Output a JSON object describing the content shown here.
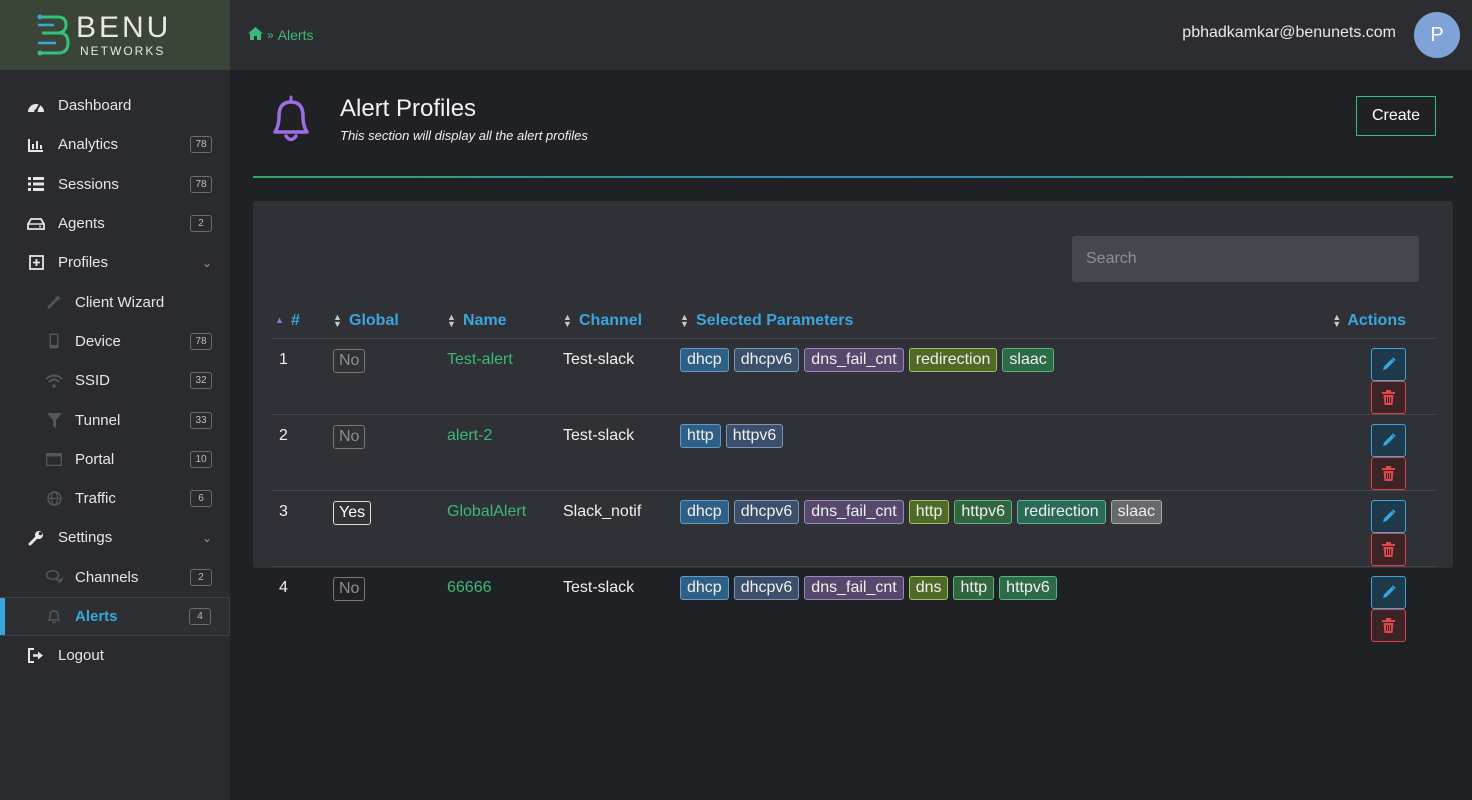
{
  "brand": {
    "name": "BENU",
    "sub": "NETWORKS"
  },
  "breadcrumb": {
    "current": "Alerts"
  },
  "user": {
    "email": "pbhadkamkar@benunets.com",
    "initial": "P"
  },
  "sidebar": {
    "items": [
      {
        "label": "Dashboard",
        "badge": "",
        "icon": "dashboard-icon"
      },
      {
        "label": "Analytics",
        "badge": "78",
        "icon": "bar-chart-icon"
      },
      {
        "label": "Sessions",
        "badge": "78",
        "icon": "list-icon"
      },
      {
        "label": "Agents",
        "badge": "2",
        "icon": "drive-icon"
      },
      {
        "label": "Profiles",
        "badge": "",
        "icon": "plus-square-icon"
      },
      {
        "label": "Client Wizard",
        "badge": "",
        "icon": "wand-icon"
      },
      {
        "label": "Device",
        "badge": "78",
        "icon": "mobile-icon"
      },
      {
        "label": "SSID",
        "badge": "32",
        "icon": "wifi-icon"
      },
      {
        "label": "Tunnel",
        "badge": "33",
        "icon": "filter-icon"
      },
      {
        "label": "Portal",
        "badge": "10",
        "icon": "window-icon"
      },
      {
        "label": "Traffic",
        "badge": "6",
        "icon": "globe-icon"
      },
      {
        "label": "Settings",
        "badge": "",
        "icon": "wrench-icon"
      },
      {
        "label": "Channels",
        "badge": "2",
        "icon": "chat-icon"
      },
      {
        "label": "Alerts",
        "badge": "4",
        "icon": "bell-icon"
      },
      {
        "label": "Logout",
        "badge": "",
        "icon": "logout-icon"
      }
    ]
  },
  "page": {
    "title": "Alert Profiles",
    "subtitle": "This section will display all the alert profiles",
    "create_label": "Create"
  },
  "search": {
    "placeholder": "Search",
    "value": ""
  },
  "table": {
    "headers": [
      "#",
      "Global",
      "Name",
      "Channel",
      "Selected Parameters",
      "Actions"
    ],
    "rows": [
      {
        "num": "1",
        "global": "No",
        "name": "Test-alert",
        "channel": "Test-slack",
        "params": [
          "dhcp",
          "dhcpv6",
          "dns_fail_cnt",
          "redirection",
          "slaac"
        ]
      },
      {
        "num": "2",
        "global": "No",
        "name": "alert-2",
        "channel": "Test-slack",
        "params": [
          "http",
          "httpv6"
        ]
      },
      {
        "num": "3",
        "global": "Yes",
        "name": "GlobalAlert",
        "channel": "Slack_notif",
        "params": [
          "dhcp",
          "dhcpv6",
          "dns_fail_cnt",
          "http",
          "httpv6",
          "redirection",
          "slaac"
        ]
      },
      {
        "num": "4",
        "global": "No",
        "name": "66666",
        "channel": "Test-slack",
        "params": [
          "dhcp",
          "dhcpv6",
          "dns_fail_cnt",
          "dns",
          "http",
          "httpv6"
        ]
      }
    ]
  },
  "colors": {
    "accent_blue": "#3aa6de",
    "accent_green": "#3cb87a",
    "tag_dhcp": "#2f5f84",
    "tag_dhcpv6": "#3c4f6a",
    "tag_dns_fail_cnt": "#55486a",
    "tag_redirection": "#4f6a26",
    "tag_slaac": "#2c6a48",
    "tag_http": "#2f5f84",
    "tag_httpv6": "#3c4f6a",
    "tag_dns": "#4f6a26",
    "tag_http_green": "#31653e",
    "tag_slaac_gray": "#66686b"
  }
}
